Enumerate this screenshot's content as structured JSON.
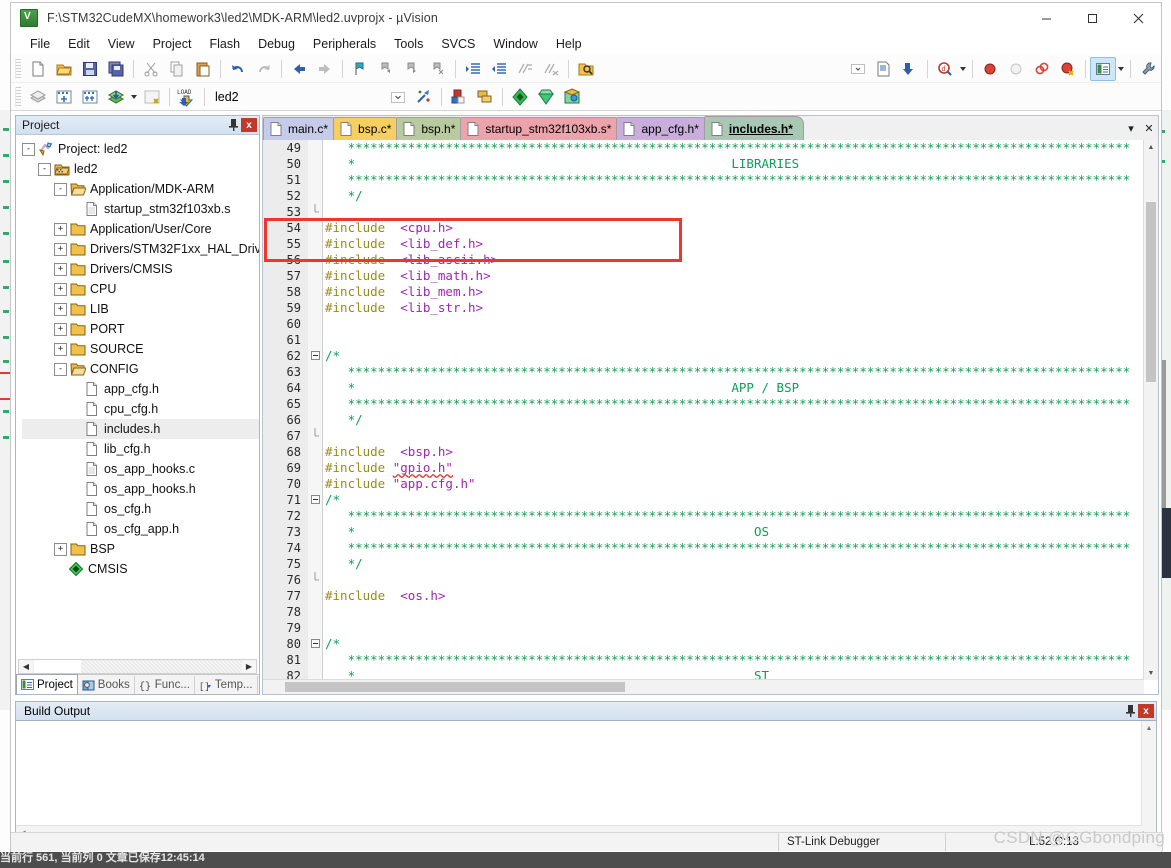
{
  "window": {
    "title": "F:\\STM32CudeMX\\homework3\\led2\\MDK-ARM\\led2.uvprojx - µVision",
    "minimize": "–",
    "maximize": "□",
    "close": "✕"
  },
  "menu": [
    "File",
    "Edit",
    "View",
    "Project",
    "Flash",
    "Debug",
    "Peripherals",
    "Tools",
    "SVCS",
    "Window",
    "Help"
  ],
  "toolbar2": {
    "project_target": "led2"
  },
  "project_panel": {
    "title": "Project",
    "pin": "pin-icon",
    "close": "x",
    "tree": [
      {
        "indent": 0,
        "toggle": "-",
        "icon": "project",
        "label": "Project: led2"
      },
      {
        "indent": 1,
        "toggle": "-",
        "icon": "target",
        "label": "led2"
      },
      {
        "indent": 2,
        "toggle": "-",
        "icon": "folder-open",
        "label": "Application/MDK-ARM"
      },
      {
        "indent": 3,
        "toggle": "",
        "icon": "file-asm",
        "label": "startup_stm32f103xb.s"
      },
      {
        "indent": 2,
        "toggle": "+",
        "icon": "folder",
        "label": "Application/User/Core"
      },
      {
        "indent": 2,
        "toggle": "+",
        "icon": "folder",
        "label": "Drivers/STM32F1xx_HAL_Driv"
      },
      {
        "indent": 2,
        "toggle": "+",
        "icon": "folder",
        "label": "Drivers/CMSIS"
      },
      {
        "indent": 2,
        "toggle": "+",
        "icon": "folder",
        "label": "CPU"
      },
      {
        "indent": 2,
        "toggle": "+",
        "icon": "folder",
        "label": "LIB"
      },
      {
        "indent": 2,
        "toggle": "+",
        "icon": "folder",
        "label": "PORT"
      },
      {
        "indent": 2,
        "toggle": "+",
        "icon": "folder",
        "label": "SOURCE"
      },
      {
        "indent": 2,
        "toggle": "-",
        "icon": "folder-open",
        "label": "CONFIG"
      },
      {
        "indent": 3,
        "toggle": "",
        "icon": "file",
        "label": "app_cfg.h"
      },
      {
        "indent": 3,
        "toggle": "",
        "icon": "file",
        "label": "cpu_cfg.h"
      },
      {
        "indent": 3,
        "toggle": "",
        "icon": "file",
        "label": "includes.h",
        "selected": true
      },
      {
        "indent": 3,
        "toggle": "",
        "icon": "file",
        "label": "lib_cfg.h"
      },
      {
        "indent": 3,
        "toggle": "",
        "icon": "file-c",
        "label": "os_app_hooks.c"
      },
      {
        "indent": 3,
        "toggle": "",
        "icon": "file",
        "label": "os_app_hooks.h"
      },
      {
        "indent": 3,
        "toggle": "",
        "icon": "file",
        "label": "os_cfg.h"
      },
      {
        "indent": 3,
        "toggle": "",
        "icon": "file",
        "label": "os_cfg_app.h"
      },
      {
        "indent": 2,
        "toggle": "+",
        "icon": "folder",
        "label": "BSP"
      },
      {
        "indent": 2,
        "toggle": "",
        "icon": "cmsis",
        "label": "CMSIS"
      }
    ],
    "bottom_tabs": [
      {
        "label": "Project",
        "icon": "project-icon",
        "active": true
      },
      {
        "label": "Books",
        "icon": "books-icon",
        "active": false
      },
      {
        "label": "Func...",
        "icon": "functions-icon",
        "active": false
      },
      {
        "label": "Temp...",
        "icon": "templates-icon",
        "active": false
      }
    ]
  },
  "editor": {
    "tabs": [
      {
        "label": "main.c*",
        "color": "#c5cbe8",
        "active": false
      },
      {
        "label": "bsp.c*",
        "color": "#f6cf63",
        "active": false
      },
      {
        "label": "bsp.h*",
        "color": "#b9c9a0",
        "active": false
      },
      {
        "label": "startup_stm32f103xb.s*",
        "color": "#eda3ab",
        "active": false
      },
      {
        "label": "app_cfg.h*",
        "color": "#c9aedb",
        "active": false
      },
      {
        "label": "includes.h*",
        "color": "#a8c7b4",
        "active": true
      }
    ],
    "tab_controls": {
      "scroll": "▾",
      "close": "✕"
    },
    "first_line": 49,
    "lines": [
      {
        "n": 49,
        "fold": "",
        "parts": [
          {
            "t": "   ********************************************************************************************************",
            "c": "cm"
          }
        ]
      },
      {
        "n": 50,
        "fold": "",
        "parts": [
          {
            "t": "   *                                                  LIBRARIES",
            "c": "cm"
          }
        ]
      },
      {
        "n": 51,
        "fold": "",
        "parts": [
          {
            "t": "   ********************************************************************************************************",
            "c": "cm"
          }
        ]
      },
      {
        "n": 52,
        "fold": "",
        "parts": [
          {
            "t": "   */",
            "c": "cm"
          }
        ]
      },
      {
        "n": 53,
        "fold": "|",
        "parts": []
      },
      {
        "n": 54,
        "fold": "",
        "parts": [
          {
            "t": "#include",
            "c": "pp"
          },
          {
            "t": "  ",
            "c": ""
          },
          {
            "t": "<cpu.h>",
            "c": "inc"
          }
        ]
      },
      {
        "n": 55,
        "fold": "",
        "parts": [
          {
            "t": "#include",
            "c": "pp"
          },
          {
            "t": "  ",
            "c": ""
          },
          {
            "t": "<lib_def.h>",
            "c": "inc"
          }
        ]
      },
      {
        "n": 56,
        "fold": "",
        "parts": [
          {
            "t": "#include",
            "c": "pp"
          },
          {
            "t": "  ",
            "c": ""
          },
          {
            "t": "<lib_ascii.h>",
            "c": "inc"
          }
        ]
      },
      {
        "n": 57,
        "fold": "",
        "parts": [
          {
            "t": "#include",
            "c": "pp"
          },
          {
            "t": "  ",
            "c": ""
          },
          {
            "t": "<lib_math.h>",
            "c": "inc"
          }
        ]
      },
      {
        "n": 58,
        "fold": "",
        "parts": [
          {
            "t": "#include",
            "c": "pp"
          },
          {
            "t": "  ",
            "c": ""
          },
          {
            "t": "<lib_mem.h>",
            "c": "inc"
          }
        ]
      },
      {
        "n": 59,
        "fold": "",
        "parts": [
          {
            "t": "#include",
            "c": "pp"
          },
          {
            "t": "  ",
            "c": ""
          },
          {
            "t": "<lib_str.h>",
            "c": "inc"
          }
        ]
      },
      {
        "n": 60,
        "fold": "",
        "parts": []
      },
      {
        "n": 61,
        "fold": "",
        "parts": []
      },
      {
        "n": 62,
        "fold": "-",
        "parts": [
          {
            "t": "/*",
            "c": "cm"
          }
        ]
      },
      {
        "n": 63,
        "fold": "",
        "parts": [
          {
            "t": "   ********************************************************************************************************",
            "c": "cm"
          }
        ]
      },
      {
        "n": 64,
        "fold": "",
        "parts": [
          {
            "t": "   *                                                  APP / BSP",
            "c": "cm"
          }
        ]
      },
      {
        "n": 65,
        "fold": "",
        "parts": [
          {
            "t": "   ********************************************************************************************************",
            "c": "cm"
          }
        ]
      },
      {
        "n": 66,
        "fold": "",
        "parts": [
          {
            "t": "   */",
            "c": "cm"
          }
        ]
      },
      {
        "n": 67,
        "fold": "|",
        "parts": []
      },
      {
        "n": 68,
        "fold": "",
        "parts": [
          {
            "t": "#include",
            "c": "pp"
          },
          {
            "t": "  ",
            "c": ""
          },
          {
            "t": "<bsp.h>",
            "c": "inc"
          }
        ]
      },
      {
        "n": 69,
        "fold": "",
        "parts": [
          {
            "t": "#include",
            "c": "pp"
          },
          {
            "t": " ",
            "c": ""
          },
          {
            "t": "\"gpio.h\"",
            "c": "inc squig"
          }
        ]
      },
      {
        "n": 70,
        "fold": "",
        "parts": [
          {
            "t": "#include",
            "c": "pp"
          },
          {
            "t": " ",
            "c": ""
          },
          {
            "t": "\"app.cfg.h\"",
            "c": "inc"
          }
        ]
      },
      {
        "n": 71,
        "fold": "-",
        "parts": [
          {
            "t": "/*",
            "c": "cm"
          }
        ]
      },
      {
        "n": 72,
        "fold": "",
        "parts": [
          {
            "t": "   ********************************************************************************************************",
            "c": "cm"
          }
        ]
      },
      {
        "n": 73,
        "fold": "",
        "parts": [
          {
            "t": "   *                                                     OS",
            "c": "cm"
          }
        ]
      },
      {
        "n": 74,
        "fold": "",
        "parts": [
          {
            "t": "   ********************************************************************************************************",
            "c": "cm"
          }
        ]
      },
      {
        "n": 75,
        "fold": "",
        "parts": [
          {
            "t": "   */",
            "c": "cm"
          }
        ]
      },
      {
        "n": 76,
        "fold": "|",
        "parts": []
      },
      {
        "n": 77,
        "fold": "",
        "parts": [
          {
            "t": "#include",
            "c": "pp"
          },
          {
            "t": "  ",
            "c": ""
          },
          {
            "t": "<os.h>",
            "c": "inc"
          }
        ]
      },
      {
        "n": 78,
        "fold": "",
        "parts": []
      },
      {
        "n": 79,
        "fold": "",
        "parts": []
      },
      {
        "n": 80,
        "fold": "-",
        "parts": [
          {
            "t": "/*",
            "c": "cm"
          }
        ]
      },
      {
        "n": 81,
        "fold": "",
        "parts": [
          {
            "t": "   ********************************************************************************************************",
            "c": "cm"
          }
        ]
      },
      {
        "n": 82,
        "fold": "",
        "parts": [
          {
            "t": "   *                                                     ST",
            "c": "cm"
          }
        ]
      }
    ]
  },
  "build_output": {
    "title": "Build Output",
    "pin": "pin-icon",
    "close": "x",
    "content": ""
  },
  "status_bar": {
    "debugger": "ST-Link Debugger",
    "position": "L:52 C:13"
  },
  "watermark": "CSDN @GGbondping",
  "os_taskbar": {
    "text": "当前行 561, 当前列 0   文章已保存12:45:14"
  }
}
